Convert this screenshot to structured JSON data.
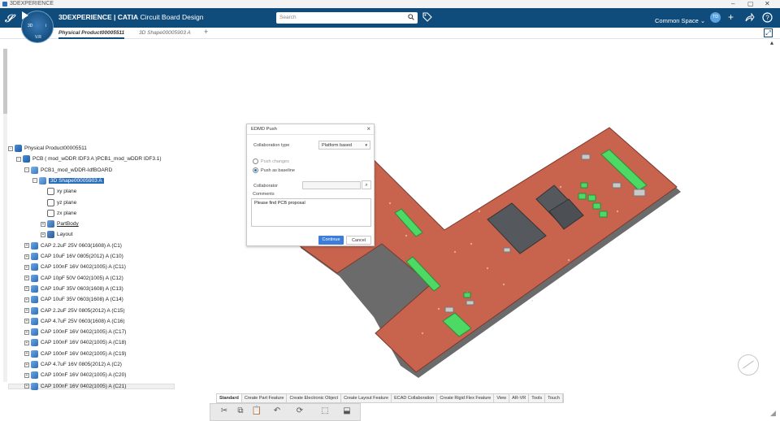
{
  "window": {
    "title": "3DEXPERIENCE",
    "controls": [
      "–",
      "▢",
      "✕"
    ]
  },
  "header": {
    "brand": "3DEXPERIENCE | CATIA",
    "app": "Circuit Board Design",
    "compass_label_left": "3D",
    "compass_label_right": "i",
    "compass_label_bottom": "V.R",
    "search_placeholder": "Search",
    "space": "Common Space",
    "avatar": "TD",
    "accent": "#0f4b7b"
  },
  "tabs": [
    {
      "label": "Physical Product00005511",
      "active": true
    },
    {
      "label": "3D Shape00005903 A",
      "active": false
    }
  ],
  "tree": [
    {
      "label": "Physical Product00005511",
      "icon": "product-icon",
      "level": 0,
      "exp": "-",
      "style": ""
    },
    {
      "label": "PCB ( mod_wDDR IDF3 A )PCB1_mod_wDDR IDF3.1)",
      "icon": "product-icon",
      "level": 1,
      "exp": "-",
      "style": ""
    },
    {
      "label": "PCB1_mod_wDDR-IdfBOARD",
      "icon": "part-icon",
      "level": 2,
      "exp": "-",
      "style": ""
    },
    {
      "label": "3D Shape00005903 A",
      "icon": "shape-icon",
      "level": 3,
      "exp": "-",
      "style": "selected"
    },
    {
      "label": "xy plane",
      "icon": "plane-icon",
      "level": 4,
      "exp": "",
      "style": ""
    },
    {
      "label": "yz plane",
      "icon": "plane-icon",
      "level": 4,
      "exp": "",
      "style": ""
    },
    {
      "label": "zx plane",
      "icon": "plane-icon",
      "level": 4,
      "exp": "",
      "style": ""
    },
    {
      "label": "PartBody",
      "icon": "body-icon",
      "level": 4,
      "exp": "+",
      "style": "underline"
    },
    {
      "label": "Layout",
      "icon": "layout-icon",
      "level": 4,
      "exp": "+",
      "style": ""
    },
    {
      "label": "CAP 2.2uF 25V 0603(1608) A (C1)",
      "icon": "cap-icon",
      "level": 2,
      "exp": "+",
      "style": ""
    },
    {
      "label": "CAP 10uF 16V 0805(2012) A (C10)",
      "icon": "cap-icon",
      "level": 2,
      "exp": "+",
      "style": ""
    },
    {
      "label": "CAP 100nF 16V 0402(1005) A (C11)",
      "icon": "cap-icon",
      "level": 2,
      "exp": "+",
      "style": ""
    },
    {
      "label": "CAP 10pF 50V 0402(1005) A (C12)",
      "icon": "cap-icon",
      "level": 2,
      "exp": "+",
      "style": ""
    },
    {
      "label": "CAP 10uF 35V 0603(1608) A (C13)",
      "icon": "cap-icon",
      "level": 2,
      "exp": "+",
      "style": ""
    },
    {
      "label": "CAP 10uF 35V 0603(1608) A (C14)",
      "icon": "cap-icon",
      "level": 2,
      "exp": "+",
      "style": ""
    },
    {
      "label": "CAP 2.2uF 25V 0805(2012) A (C15)",
      "icon": "cap-icon",
      "level": 2,
      "exp": "+",
      "style": ""
    },
    {
      "label": "CAP 4.7uF 25V 0603(1608) A (C16)",
      "icon": "cap-icon",
      "level": 2,
      "exp": "+",
      "style": ""
    },
    {
      "label": "CAP 100nF 16V 0402(1005) A (C17)",
      "icon": "cap-icon",
      "level": 2,
      "exp": "+",
      "style": ""
    },
    {
      "label": "CAP 100nF 16V 0402(1005) A (C18)",
      "icon": "cap-icon",
      "level": 2,
      "exp": "+",
      "style": ""
    },
    {
      "label": "CAP 100nF 16V 0402(1005) A (C19)",
      "icon": "cap-icon",
      "level": 2,
      "exp": "+",
      "style": ""
    },
    {
      "label": "CAP 4.7uF 16V 0805(2012) A (C2)",
      "icon": "cap-icon",
      "level": 2,
      "exp": "+",
      "style": ""
    },
    {
      "label": "CAP 100nF 16V 0402(1005) A (C20)",
      "icon": "cap-icon",
      "level": 2,
      "exp": "+",
      "style": ""
    },
    {
      "label": "CAP 100nF 16V 0402(1005) A (C21)",
      "icon": "cap-icon",
      "level": 2,
      "exp": "+",
      "style": ""
    }
  ],
  "dialog": {
    "title": "EDMD Push",
    "collab_type_label": "Collaboration type",
    "collab_type_value": "Platform based",
    "option_push_changes": "Push changes",
    "option_push_baseline": "Push as baseline",
    "selected_option": "Push as baseline",
    "collaborator_label": "Collaborator",
    "collaborator_value": "",
    "comments_label": "Comments",
    "comments_value": "Please find PCB proposal",
    "continue_label": "Continue",
    "cancel_label": "Cancel"
  },
  "ribbon": {
    "tabs": [
      "Standard",
      "Create Part Feature",
      "Create Electronic Object",
      "Create Layout Feature",
      "ECAD Collaboration",
      "Create Rigid Flex Feature",
      "View",
      "AR-VR",
      "Tools",
      "Touch"
    ],
    "active_tab": "Standard",
    "icons": [
      "cut-icon",
      "copy-icon",
      "paste-icon",
      "undo-icon",
      "update-icon",
      "product-view-icon",
      "part-view-icon"
    ]
  },
  "board": {
    "substrate_color": "#c8634e",
    "component_color": "#4cd964",
    "chip_color": "#555a5e"
  }
}
